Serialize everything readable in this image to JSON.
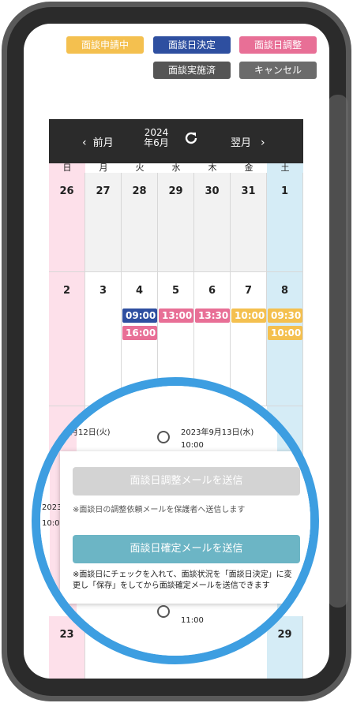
{
  "legend": {
    "pending": {
      "label": "面談申請中",
      "color": "#f4c04f"
    },
    "decided": {
      "label": "面談日決定",
      "color": "#2e4fa0"
    },
    "adjusting": {
      "label": "面談日調整",
      "color": "#e86f96"
    },
    "done": {
      "label": "面談実施済",
      "color": "#555555"
    },
    "cancel": {
      "label": "キャンセル",
      "color": "#6b6b6b"
    }
  },
  "calendar": {
    "prev": "前月",
    "year": "2024",
    "month": "年6月",
    "next": "翌月",
    "weekdays": [
      "日",
      "月",
      "火",
      "水",
      "木",
      "金",
      "土"
    ],
    "week1": [
      "26",
      "27",
      "28",
      "29",
      "30",
      "31",
      "1"
    ],
    "week2": [
      "2",
      "3",
      "4",
      "5",
      "6",
      "7",
      "8"
    ],
    "week_bottom": {
      "sun": "23",
      "sat": "29"
    },
    "events": {
      "tue_1": "09:00",
      "tue_2": "16:00",
      "wed_1": "13:00",
      "thu_1": "13:30",
      "fri_1": "10:00",
      "sat_1": "09:30",
      "sat_2": "10:00"
    }
  },
  "zoom": {
    "date_left": "月12日(火)",
    "date_right": "2023年9月13日(水)",
    "time_right": "10:00",
    "left_cut": "2023",
    "left_time": "10:0",
    "btn_adjust": "面談日調整メールを送信",
    "note_adjust": "※面談日の調整依頼メールを保護者へ送信します",
    "btn_confirm": "面談日確定メールを送信",
    "note_confirm_1": "※面談日にチェックを入れて、面談状況を「面談日決定」に変",
    "note_confirm_2": "更し「保存」をしてから面談確定メールを送信できます",
    "bottom_time": "11:00",
    "bottom_day_left": "23",
    "bottom_day_right": "29"
  }
}
